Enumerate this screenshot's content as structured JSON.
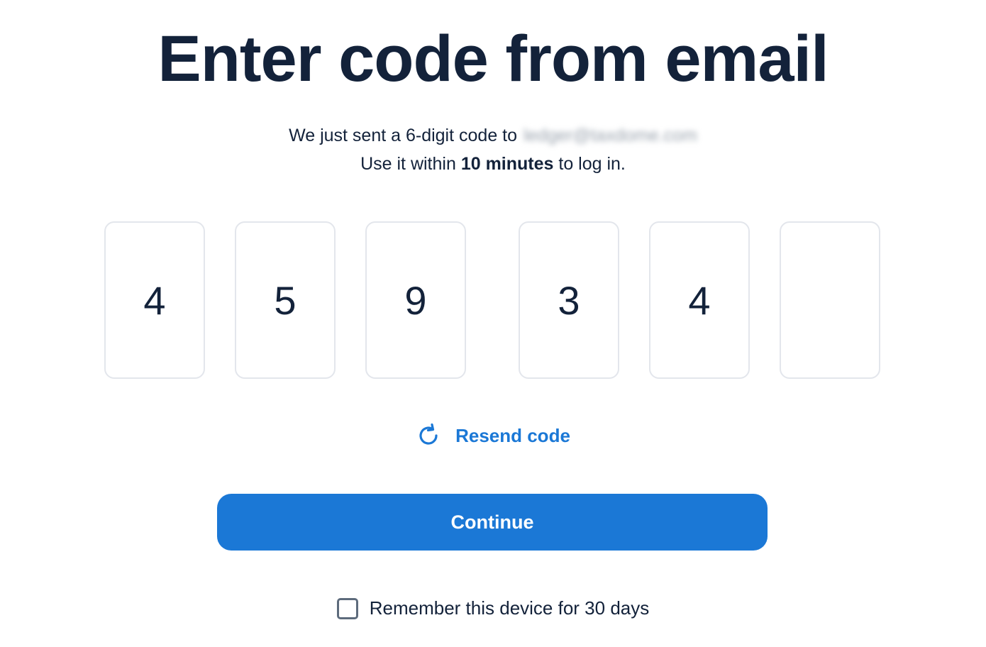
{
  "title": "Enter code from email",
  "subtitle": {
    "line1_prefix": "We just sent a 6-digit code to",
    "email": "ledger@taxdome.com",
    "line2_prefix": "Use it within",
    "line2_bold": "10 minutes",
    "line2_suffix": "to log in."
  },
  "code": {
    "digits": [
      "4",
      "5",
      "9",
      "3",
      "4",
      ""
    ]
  },
  "resend": {
    "label": "Resend code",
    "icon": "refresh-icon"
  },
  "continue_label": "Continue",
  "remember": {
    "label": "Remember this device for 30 days",
    "checked": false
  },
  "colors": {
    "accent": "#1b78d6",
    "text": "#13223a",
    "box_border": "#e3e6ec"
  }
}
